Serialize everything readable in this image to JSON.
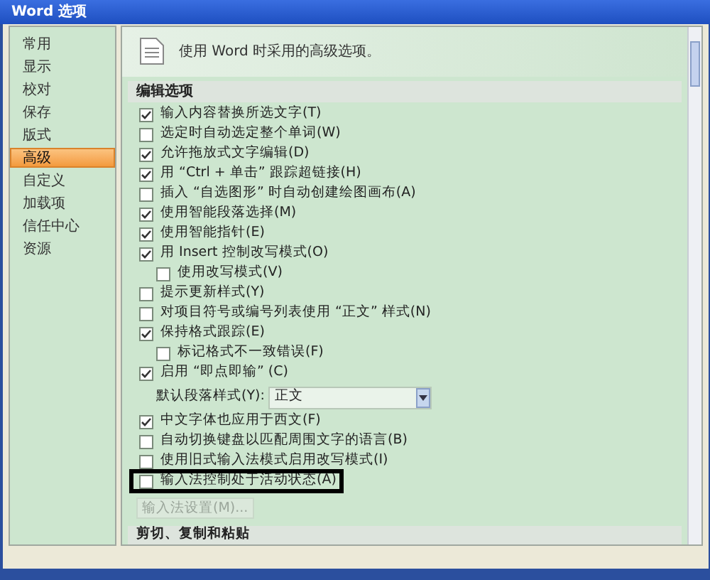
{
  "window": {
    "title": "Word 选项"
  },
  "sidebar": {
    "items": [
      {
        "label": "常用",
        "selected": false
      },
      {
        "label": "显示",
        "selected": false
      },
      {
        "label": "校对",
        "selected": false
      },
      {
        "label": "保存",
        "selected": false
      },
      {
        "label": "版式",
        "selected": false
      },
      {
        "label": "高级",
        "selected": true
      },
      {
        "label": "自定义",
        "selected": false
      },
      {
        "label": "加载项",
        "selected": false
      },
      {
        "label": "信任中心",
        "selected": false
      },
      {
        "label": "资源",
        "selected": false
      }
    ]
  },
  "header": {
    "text": "使用 Word 时采用的高级选项。"
  },
  "section": {
    "title": "编辑选项",
    "options": [
      {
        "kind": "checkbox",
        "label": "输入内容替换所选文字(T)",
        "checked": true,
        "indented": false,
        "highlighted": false
      },
      {
        "kind": "checkbox",
        "label": "选定时自动选定整个单词(W)",
        "checked": false,
        "indented": false,
        "highlighted": false
      },
      {
        "kind": "checkbox",
        "label": "允许拖放式文字编辑(D)",
        "checked": true,
        "indented": false,
        "highlighted": false
      },
      {
        "kind": "checkbox",
        "label": "用 “Ctrl + 单击” 跟踪超链接(H)",
        "checked": true,
        "indented": false,
        "highlighted": false
      },
      {
        "kind": "checkbox",
        "label": "插入 “自选图形” 时自动创建绘图画布(A)",
        "checked": false,
        "indented": false,
        "highlighted": false
      },
      {
        "kind": "checkbox",
        "label": "使用智能段落选择(M)",
        "checked": true,
        "indented": false,
        "highlighted": false
      },
      {
        "kind": "checkbox",
        "label": "使用智能指针(E)",
        "checked": true,
        "indented": false,
        "highlighted": false
      },
      {
        "kind": "checkbox",
        "label": "用 Insert 控制改写模式(O)",
        "checked": true,
        "indented": false,
        "highlighted": false
      },
      {
        "kind": "checkbox",
        "label": "使用改写模式(V)",
        "checked": false,
        "indented": true,
        "highlighted": false
      },
      {
        "kind": "checkbox",
        "label": "提示更新样式(Y)",
        "checked": false,
        "indented": false,
        "highlighted": false
      },
      {
        "kind": "checkbox",
        "label": "对项目符号或编号列表使用 “正文” 样式(N)",
        "checked": false,
        "indented": false,
        "highlighted": false
      },
      {
        "kind": "checkbox",
        "label": "保持格式跟踪(E)",
        "checked": true,
        "indented": false,
        "highlighted": false
      },
      {
        "kind": "checkbox",
        "label": "标记格式不一致错误(F)",
        "checked": false,
        "indented": true,
        "highlighted": false
      },
      {
        "kind": "checkbox",
        "label": "启用 “即点即输” (C)",
        "checked": true,
        "indented": false,
        "highlighted": false
      },
      {
        "kind": "select",
        "label": "默认段落样式(Y):",
        "value": "正文"
      },
      {
        "kind": "checkbox",
        "label": "中文字体也应用于西文(F)",
        "checked": true,
        "indented": false,
        "highlighted": false
      },
      {
        "kind": "checkbox",
        "label": "自动切换键盘以匹配周围文字的语言(B)",
        "checked": false,
        "indented": false,
        "highlighted": false
      },
      {
        "kind": "checkbox",
        "label": "使用旧式输入法模式启用改写模式(I)",
        "checked": false,
        "indented": false,
        "highlighted": false
      },
      {
        "kind": "checkbox",
        "label": "输入法控制处于活动状态(A)",
        "checked": false,
        "indented": false,
        "highlighted": true
      },
      {
        "kind": "button",
        "label": "输入法设置(M)...",
        "disabled": true
      }
    ]
  },
  "next_section": {
    "title": "剪切、复制和粘贴"
  }
}
